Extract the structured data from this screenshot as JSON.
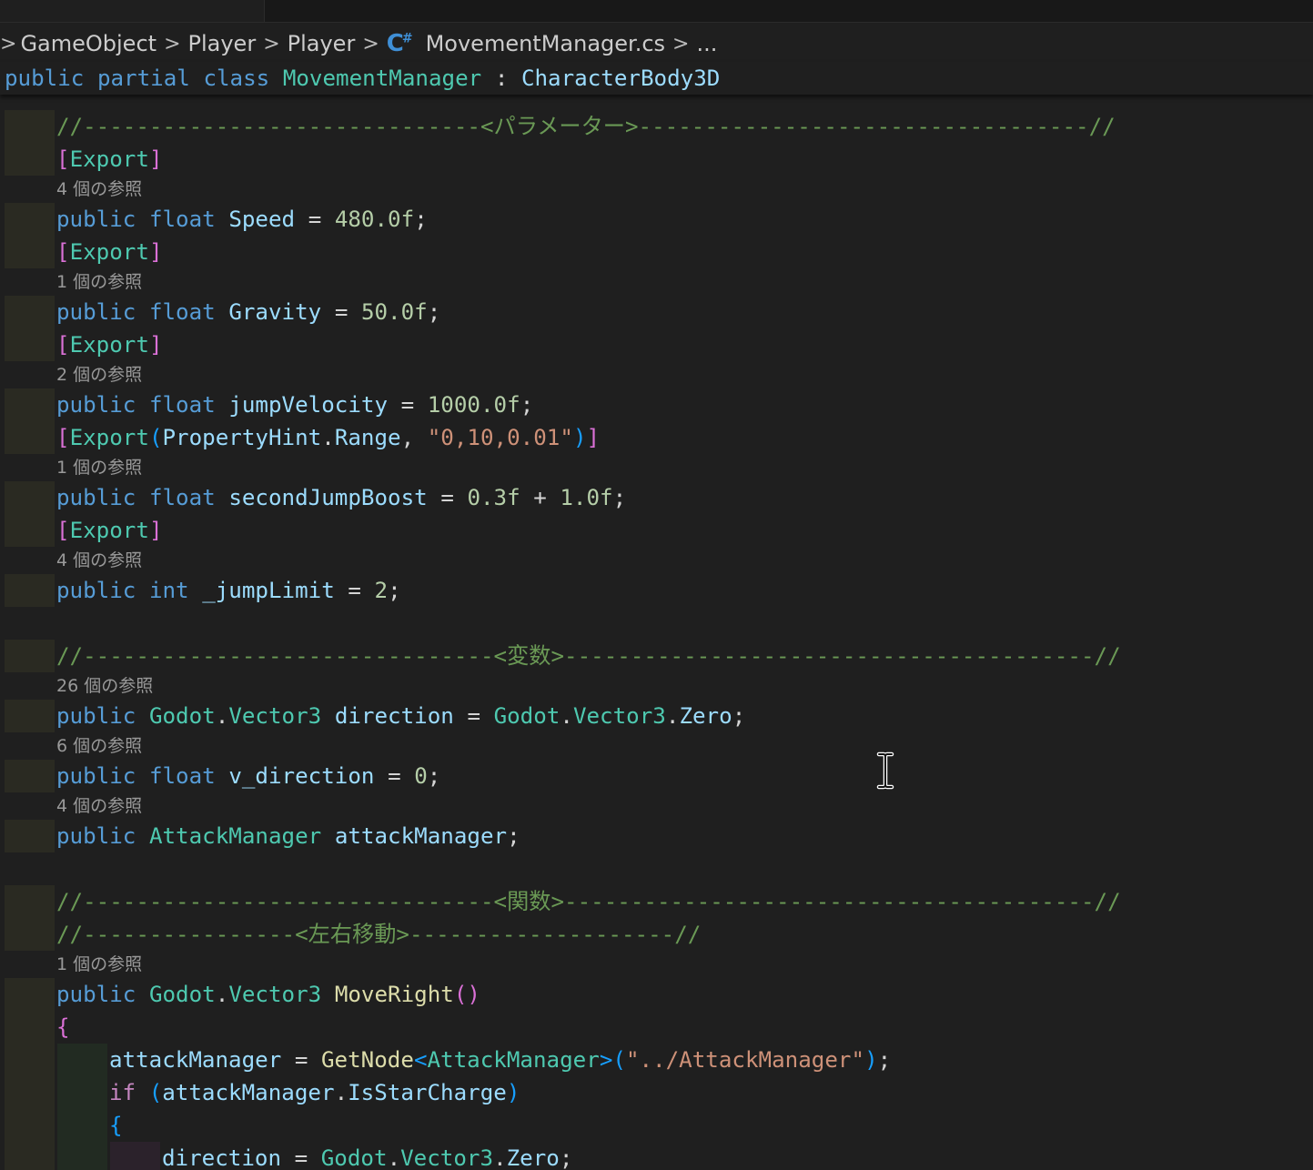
{
  "breadcrumbs": {
    "items": [
      "GameObject",
      "Player",
      "Player",
      "MovementManager.cs",
      "..."
    ],
    "file_icon": "csharp-file-icon"
  },
  "sticky_line": {
    "text": "public partial class MovementManager : CharacterBody3D"
  },
  "code_lens": {
    "speed": "4 個の参照",
    "gravity": "1 個の参照",
    "jump_velocity": "2 個の参照",
    "second_jump": "1 個の参照",
    "jump_limit": "4 個の参照",
    "direction": "26 個の参照",
    "v_direction": "6 個の参照",
    "attack_manager": "4 個の参照",
    "move_right": "1 個の参照"
  },
  "code": {
    "param_header": "//------------------------------<パラメーター>----------------------------------//",
    "export": "[Export]",
    "speed_line": "public float Speed = 480.0f;",
    "gravity_line": "public float Gravity = 50.0f;",
    "jump_velocity_line": "public float jumpVelocity = 1000.0f;",
    "export_range": "[Export(PropertyHint.Range, \"0,10,0.01\")]",
    "second_jump_line": "public float secondJumpBoost = 0.3f + 1.0f;",
    "jump_limit_line": "public int _jumpLimit = 2;",
    "var_header": "//-------------------------------<変数>----------------------------------------//",
    "direction_line": "public Godot.Vector3 direction = Godot.Vector3.Zero;",
    "v_direction_line": "public float v_direction = 0;",
    "attack_manager_line": "public AttackManager attackManager;",
    "func_header": "//-------------------------------<関数>----------------------------------------//",
    "move_header": "//----------------<左右移動>--------------------//",
    "move_right_sig": "public Godot.Vector3 MoveRight()",
    "open_brace": "{",
    "get_node_line": "attackManager = GetNode<AttackManager>(\"../AttackManager\");",
    "if_line": "if (attackManager.IsStarCharge)",
    "inner_brace": "{",
    "direction_zero_line": "direction = Godot.Vector3.Zero;"
  },
  "colors": {
    "background": "#1f1f1f",
    "keyword": "#569cd6",
    "control": "#c586c0",
    "type": "#4ec9b0",
    "function": "#dcdcaa",
    "number": "#b5cea8",
    "string": "#ce9178",
    "comment": "#6a9955",
    "identifier": "#9cdcfe"
  }
}
